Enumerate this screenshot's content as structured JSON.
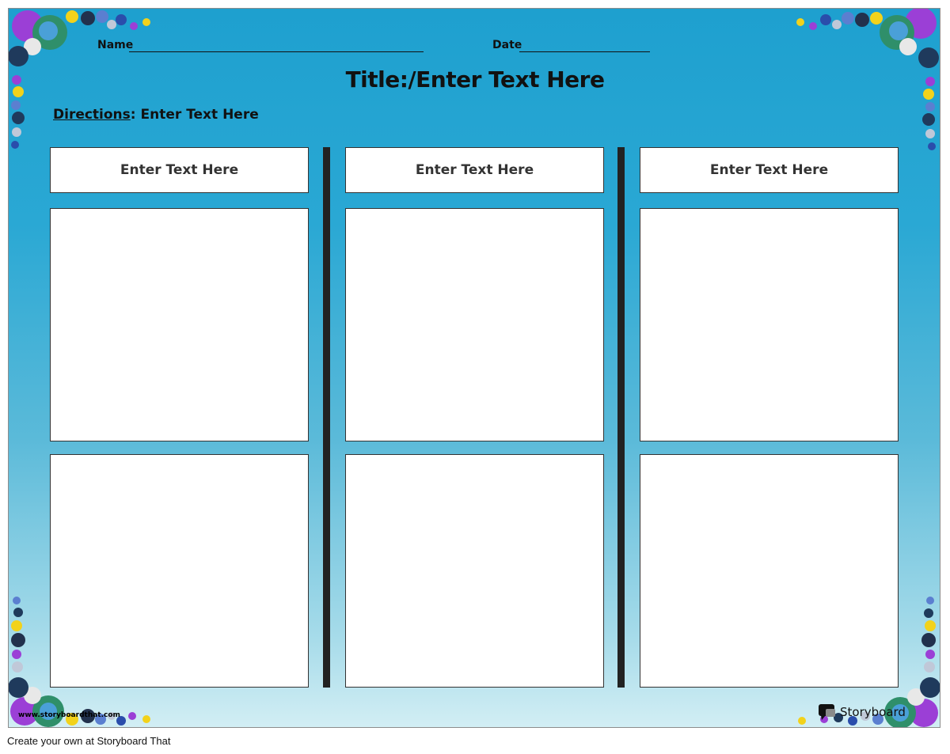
{
  "header": {
    "name_label": "Name",
    "date_label": "Date"
  },
  "title": "Title:/Enter Text Here",
  "directions": {
    "label": "Directions",
    "text": ": Enter Text Here"
  },
  "columns": [
    {
      "heading": "Enter Text Here"
    },
    {
      "heading": "Enter Text Here"
    },
    {
      "heading": "Enter Text Here"
    }
  ],
  "footer": {
    "url": "www.storyboardthat.com",
    "brand": "Storyboard",
    "caption": "Create your own at Storyboard That"
  },
  "colors": {
    "background_top": "#1ea0cf",
    "background_bottom": "#d2eef4",
    "divider": "#222222"
  },
  "icons": [
    "planet-cluster-icon",
    "speech-bubble-logo-icon"
  ]
}
